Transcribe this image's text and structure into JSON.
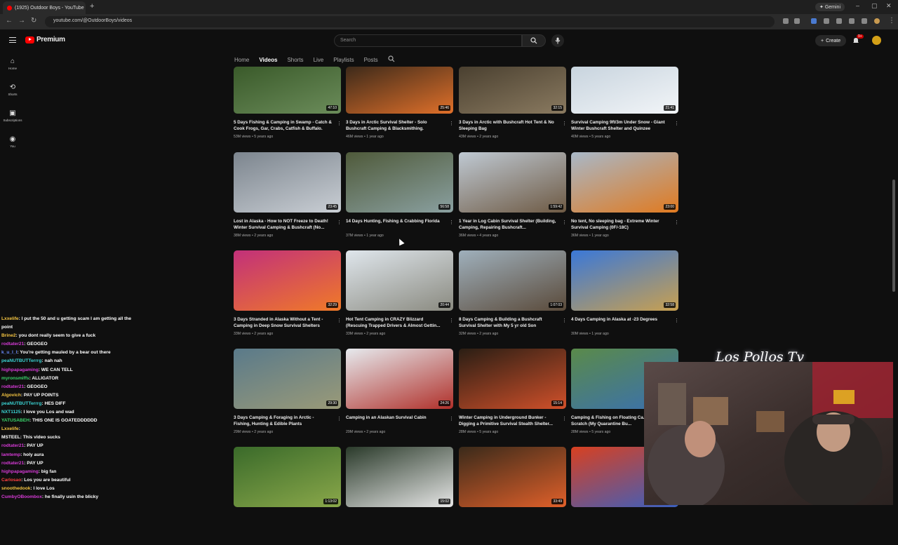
{
  "browser": {
    "tab_title": "(1925) Outdoor Boys - YouTube",
    "tab_close": "×",
    "new_tab": "+",
    "gemini_label": "Gemini",
    "url": "youtube.com/@OutdoorBoys/videos"
  },
  "header": {
    "brand": "Premium",
    "search_placeholder": "Search",
    "create_label": "Create",
    "notification_count": "9+"
  },
  "sidebar": {
    "items": [
      {
        "label": "Home",
        "icon": "home-icon"
      },
      {
        "label": "Shorts",
        "icon": "shorts-icon"
      },
      {
        "label": "Subscriptions",
        "icon": "subscriptions-icon"
      },
      {
        "label": "You",
        "icon": "you-icon"
      }
    ]
  },
  "channel_tabs": [
    "Home",
    "Videos",
    "Shorts",
    "Live",
    "Playlists",
    "Posts"
  ],
  "videos": [
    {
      "title": "5 Days Fishing & Camping in Swamp - Catch & Cook Frogs, Gar, Crabs, Catfish & Buffalo.",
      "meta": "53M views • 5 years ago",
      "duration": "47:10"
    },
    {
      "title": "3 Days in Arctic Survival Shelter - Solo Bushcraft Camping & Blacksmithing.",
      "meta": "46M views • 1 year ago",
      "duration": "25:46"
    },
    {
      "title": "3 Days in Arctic with Bushcraft Hot Tent & No Sleeping Bag",
      "meta": "43M views • 2 years ago",
      "duration": "32:15"
    },
    {
      "title": "Survival Camping 9ft/3m Under Snow - Giant Winter Bushcraft Shelter and Quinzee",
      "meta": "40M views • 5 years ago",
      "duration": "21:41"
    },
    {
      "title": "Lost in Alaska - How to NOT Freeze to Death! Winter Survival Camping & Bushcraft (No...",
      "meta": "38M views • 2 years ago",
      "duration": "23:45"
    },
    {
      "title": "14 Days Hunting, Fishing & Crabbing Florida",
      "meta": "37M views • 1 year ago",
      "duration": "56:58"
    },
    {
      "title": "1 Year in Log Cabin Survival Shelter (Building, Camping, Repairing Bushcraft...",
      "meta": "36M views • 4 years ago",
      "duration": "1:59:42"
    },
    {
      "title": "No tent, No sleeping bag - Extreme Winter Survival Camping (0F/-18C)",
      "meta": "36M views • 1 year ago",
      "duration": "23:00"
    },
    {
      "title": "3 Days Stranded in Alaska Without a Tent - Camping in Deep Snow Survival Shelters",
      "meta": "33M views • 2 years ago",
      "duration": "32:29"
    },
    {
      "title": "Hot Tent Camping in CRAZY Blizzard (Rescuing Trapped Drivers & Almost Gettin...",
      "meta": "33M views • 2 years ago",
      "duration": "20:44"
    },
    {
      "title": "8 Days Camping & Building a Bushcraft Survival Shelter with My 5 yr old Son",
      "meta": "32M views • 2 years ago",
      "duration": "1:07:03"
    },
    {
      "title": "4 Days Camping in Alaska at -23 Degrees",
      "meta": "30M views • 1 year ago",
      "duration": "32:58"
    },
    {
      "title": "3 Days Camping & Foraging in Arctic - Fishing, Hunting & Edible Plants",
      "meta": "29M views • 2 years ago",
      "duration": "29:30"
    },
    {
      "title": "Camping in an Alaskan Survival Cabin",
      "meta": "29M views • 2 years ago",
      "duration": "24:26"
    },
    {
      "title": "Winter Camping in Underground Bunker - Digging a Primitive Survival Stealth Shelter...",
      "meta": "28M views • 5 years ago",
      "duration": "15:14"
    },
    {
      "title": "Camping & Fishing on Floating Ca... From Scratch (My Quarantine Bu...",
      "meta": "28M views • 5 years ago",
      "duration": ""
    },
    {
      "title": "",
      "meta": "",
      "duration": "1:13:02"
    },
    {
      "title": "",
      "meta": "",
      "duration": "15:02"
    },
    {
      "title": "",
      "meta": "",
      "duration": "33:49"
    },
    {
      "title": "",
      "meta": "",
      "duration": ""
    }
  ],
  "overlay": {
    "signature": "Los Pollos Tv"
  },
  "chat": [
    {
      "user": "Lxxelife",
      "color": "#f5c542",
      "msg": "I put the 50 and u getting scam I am getting all the"
    },
    {
      "user": "",
      "color": "#ffffff",
      "msg": "point"
    },
    {
      "user": "Brine2",
      "color": "#f5c542",
      "msg": "you dont really seem to give a fuck"
    },
    {
      "user": "rodtater21",
      "color": "#d63bd6",
      "msg": "GEOGEO"
    },
    {
      "user": "k_u_l_l",
      "color": "#6a8cff",
      "msg": "You're getting mauled by a bear out there"
    },
    {
      "user": "peaNUTBUTTerrrg",
      "color": "#3ad3d3",
      "msg": "nah nah"
    },
    {
      "user": "highpapagaming",
      "color": "#d63bd6",
      "msg": "WE CAN TELL"
    },
    {
      "user": "myronsmiffs",
      "color": "#3ad36a",
      "msg": "ALLIGATOR"
    },
    {
      "user": "rodtater21",
      "color": "#d63bd6",
      "msg": "GEOGEO"
    },
    {
      "user": "Algovich",
      "color": "#f5c542",
      "msg": "PAY UP POINTS"
    },
    {
      "user": "peaNUTBUTTerrrg",
      "color": "#3ad3d3",
      "msg": "HES DIFF"
    },
    {
      "user": "NXT1125",
      "color": "#3ad3d3",
      "msg": "I love you Los and wad"
    },
    {
      "user": "YATUSABEH",
      "color": "#3ad36a",
      "msg": "THIS ONE IS GOATEDDDDDD"
    },
    {
      "user": "Lxxelife",
      "color": "#f5c542",
      "msg": ""
    },
    {
      "user": "MSTEEL",
      "color": "#ffffff",
      "msg": "This video sucks"
    },
    {
      "user": "rodtater21",
      "color": "#d63bd6",
      "msg": "PAY UP"
    },
    {
      "user": "Iamtemp",
      "color": "#d63bd6",
      "msg": "holy aura"
    },
    {
      "user": "rodtater21",
      "color": "#d63bd6",
      "msg": "PAY UP"
    },
    {
      "user": "highpapagaming",
      "color": "#d63bd6",
      "msg": "big fan"
    },
    {
      "user": "Carlosao",
      "color": "#ff4040",
      "msg": "Los you are beautiful"
    },
    {
      "user": "snoothedook",
      "color": "#f5c542",
      "msg": "I love Los"
    },
    {
      "user": "CumbyOBoombox",
      "color": "#d63bd6",
      "msg": "he finally usin the blicky"
    }
  ],
  "thumb_colors": [
    [
      "#3a5a2a",
      "#6b8c5a"
    ],
    [
      "#3d2a1a",
      "#e0702a"
    ],
    [
      "#4a4030",
      "#8a7a60"
    ],
    [
      "#c8d4de",
      "#f2f5f8"
    ],
    [
      "#7c858e",
      "#c9ced4"
    ],
    [
      "#4f5a3a",
      "#8aa0a0"
    ],
    [
      "#bfc9d3",
      "#6e5a44"
    ],
    [
      "#a8b8c8",
      "#e07a20"
    ],
    [
      "#c2307a",
      "#f07a28"
    ],
    [
      "#dfe6ec",
      "#8a8a80"
    ],
    [
      "#9fb0bc",
      "#5a4a3a"
    ],
    [
      "#3a78d8",
      "#c8a050"
    ],
    [
      "#5a7a8a",
      "#9a9a78"
    ],
    [
      "#e6eaee",
      "#b0302a"
    ],
    [
      "#2a1e14",
      "#d0502a"
    ],
    [
      "#5a8a4a",
      "#3a70b0"
    ],
    [
      "#3a6a2a",
      "#8aa84a"
    ],
    [
      "#2a3a2a",
      "#e6e6e6"
    ],
    [
      "#3a2a1a",
      "#e0602a"
    ],
    [
      "#d84020",
      "#3a60c0"
    ]
  ]
}
